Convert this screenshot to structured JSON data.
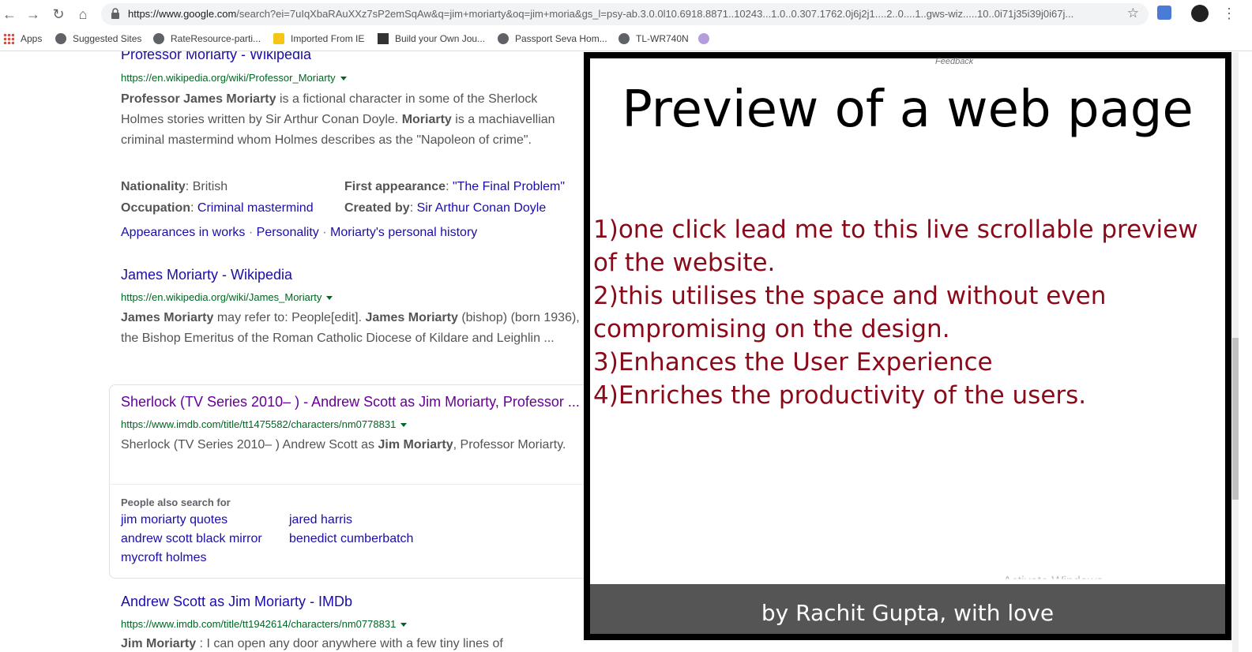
{
  "browser": {
    "url_host": "https://www.google.com",
    "url_rest": "/search?ei=7uIqXbaRAuXXz7sP2emSqAw&q=jim+moriarty&oq=jim+moria&gs_l=psy-ab.3.0.0l10.6918.8871..10243...1.0..0.307.1762.0j6j2j1....2..0....1..gws-wiz.....10..0i71j35i39j0i67j...",
    "bookmarks": [
      "Apps",
      "Suggested Sites",
      "RateResource-parti...",
      "Imported From IE",
      "Build your Own Jou...",
      "Passport Seva Hom...",
      "TL-WR740N"
    ]
  },
  "results": [
    {
      "title": "Professor Moriarty - Wikipedia",
      "url": "https://en.wikipedia.org/wiki/Professor_Moriarty",
      "snippet_html": "<b>Professor James Moriarty</b> is a fictional character in some of the Sherlock Holmes stories written by Sir Arthur Conan Doyle. <b>Moriarty</b> is a machiavellian criminal mastermind whom Holmes describes as the \"Napoleon of crime\".",
      "facts": {
        "nationality_k": "Nationality",
        "nationality_v": ": British",
        "occupation_k": "Occupation",
        "occupation_v": "Criminal mastermind",
        "first_k": "First appearance",
        "first_v": "\"The Final Problem\"",
        "created_k": "Created by",
        "created_v": "Sir Arthur Conan Doyle"
      },
      "sitelinks": [
        "Appearances in works",
        "Personality",
        "Moriarty's personal history"
      ]
    },
    {
      "title": "James Moriarty - Wikipedia",
      "url": "https://en.wikipedia.org/wiki/James_Moriarty",
      "snippet_html": "<b>James Moriarty</b> may refer to: People[edit]. <b>James Moriarty</b> (bishop) (born 1936), the Bishop Emeritus of the Roman Catholic Diocese of Kildare and Leighlin ..."
    },
    {
      "title": "Sherlock (TV Series 2010– ) - Andrew Scott as Jim Moriarty, Professor ...",
      "url": "https://www.imdb.com/title/tt1475582/characters/nm0778831",
      "snippet_html": "Sherlock (TV Series 2010– ) Andrew Scott as <b>Jim Moriarty</b>, Professor Moriarty."
    },
    {
      "title": "Andrew Scott as Jim Moriarty - IMDb",
      "url": "https://www.imdb.com/title/tt1942614/characters/nm0778831",
      "snippet_html": "<b>Jim Moriarty</b> : I can open any door anywhere with a few tiny lines of"
    }
  ],
  "people_also_search": {
    "heading": "People also search for",
    "items": [
      "jim moriarty quotes",
      "jared harris",
      "andrew scott black mirror",
      "benedict cumberbatch",
      "mycroft holmes"
    ]
  },
  "preview": {
    "feedback": "Feedback",
    "title": "Preview of a web page",
    "points": [
      "1)one click lead me to this live scrollable preview of the website.",
      "2)this utilises the space and without even compromising on the design.",
      "3)Enhances the User Experience",
      "4)Enriches the productivity of the users."
    ],
    "footer": "by Rachit Gupta, with love",
    "watermark": "Activate Windows"
  }
}
